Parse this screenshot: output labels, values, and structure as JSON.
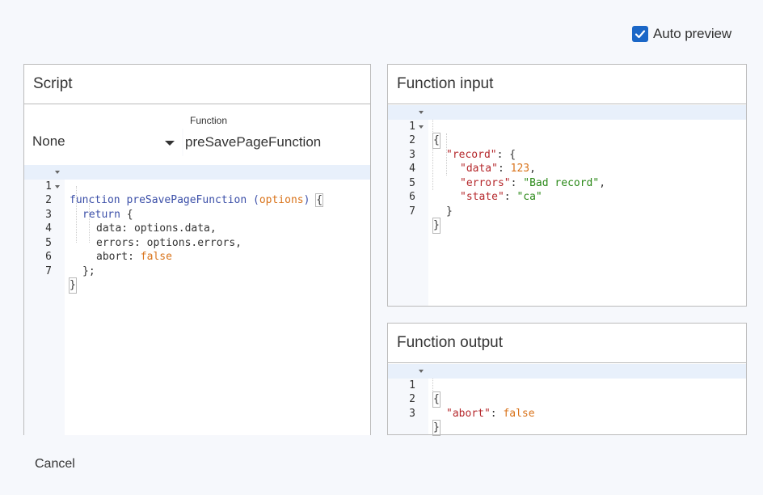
{
  "auto_preview": {
    "label": "Auto preview",
    "checked": true
  },
  "script_panel": {
    "title": "Script",
    "select_value": "None",
    "function_label": "Function",
    "function_value": "preSavePageFunction",
    "lines": [
      {
        "n": "1",
        "fold": true
      },
      {
        "n": "2",
        "fold": true
      },
      {
        "n": "3",
        "fold": false
      },
      {
        "n": "4",
        "fold": false
      },
      {
        "n": "5",
        "fold": false
      },
      {
        "n": "6",
        "fold": false
      },
      {
        "n": "7",
        "fold": false
      }
    ],
    "code": {
      "l1_kw": "function",
      "l1_fn": "preSavePageFunction",
      "l1_open": "(",
      "l1_param": "options",
      "l1_close": ")",
      "l1_brace": "{",
      "l2_kw": "return",
      "l2_brace": "{",
      "l3": "data: options.data,",
      "l4": "errors: options.errors,",
      "l5_key": "abort: ",
      "l5_val": "false",
      "l6": "};",
      "l7": "}"
    }
  },
  "input_panel": {
    "title": "Function input",
    "lines": [
      {
        "n": "1",
        "fold": true
      },
      {
        "n": "2",
        "fold": true
      },
      {
        "n": "3",
        "fold": false
      },
      {
        "n": "4",
        "fold": false
      },
      {
        "n": "5",
        "fold": false
      },
      {
        "n": "6",
        "fold": false
      },
      {
        "n": "7",
        "fold": false
      }
    ],
    "code": {
      "l1": "{",
      "l2_key": "\"record\"",
      "l2_rest": ": {",
      "l3_key": "\"data\"",
      "l3_sep": ": ",
      "l3_val": "123",
      "l3_end": ",",
      "l4_key": "\"errors\"",
      "l4_sep": ": ",
      "l4_val": "\"Bad record\"",
      "l4_end": ",",
      "l5_key": "\"state\"",
      "l5_sep": ": ",
      "l5_val": "\"ca\"",
      "l6": "}",
      "l7": "}"
    }
  },
  "output_panel": {
    "title": "Function output",
    "lines": [
      {
        "n": "1",
        "fold": true
      },
      {
        "n": "2",
        "fold": false
      },
      {
        "n": "3",
        "fold": false
      }
    ],
    "code": {
      "l1": "{",
      "l2_key": "\"abort\"",
      "l2_sep": ": ",
      "l2_val": "false",
      "l3": "}"
    }
  },
  "cancel_label": "Cancel",
  "colors": {
    "accent": "#1b67c7",
    "keyword": "#3b4fa8",
    "literal": "#d9731a",
    "json_key": "#b5282c",
    "json_string": "#2c8a1a"
  }
}
